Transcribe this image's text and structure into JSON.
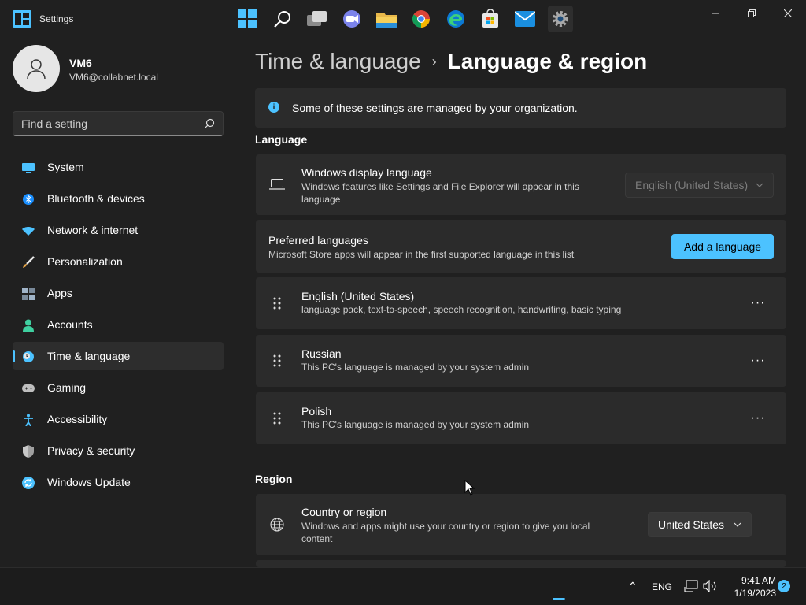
{
  "window": {
    "title": "Settings",
    "controls": {
      "minimize": "–",
      "maximize": "⧉",
      "close": "✕"
    }
  },
  "profile": {
    "name": "VM6",
    "email": "VM6@collabnet.local"
  },
  "search": {
    "placeholder": "Find a setting"
  },
  "sidebar": {
    "items": [
      {
        "label": "System",
        "icon": "system-icon",
        "color": "#4cc2ff"
      },
      {
        "label": "Bluetooth & devices",
        "icon": "bluetooth-icon",
        "color": "#1a8fff"
      },
      {
        "label": "Network & internet",
        "icon": "network-icon",
        "color": "#4cc2ff"
      },
      {
        "label": "Personalization",
        "icon": "brush-icon",
        "color": "#e8a74a"
      },
      {
        "label": "Apps",
        "icon": "apps-icon",
        "color": "#a0b4c8"
      },
      {
        "label": "Accounts",
        "icon": "accounts-icon",
        "color": "#3fd0a0"
      },
      {
        "label": "Time & language",
        "icon": "time-language-icon",
        "color": "#4cc2ff",
        "active": true
      },
      {
        "label": "Gaming",
        "icon": "gaming-icon",
        "color": "#bfbfbf"
      },
      {
        "label": "Accessibility",
        "icon": "accessibility-icon",
        "color": "#4cc2ff"
      },
      {
        "label": "Privacy & security",
        "icon": "shield-icon",
        "color": "#a0a0a0"
      },
      {
        "label": "Windows Update",
        "icon": "update-icon",
        "color": "#4cc2ff"
      }
    ]
  },
  "breadcrumb": {
    "parent": "Time & language",
    "separator": "›",
    "current": "Language & region"
  },
  "info_bar": {
    "icon": "i",
    "text": "Some of these settings are managed by your organization."
  },
  "language_section": {
    "heading": "Language",
    "display_language": {
      "title": "Windows display language",
      "subtitle_line1": "Windows features like Settings and File Explorer will appear in this",
      "subtitle_line2": "language",
      "value": "English (United States)"
    },
    "preferred": {
      "title": "Preferred languages",
      "subtitle": "Microsoft Store apps will appear in the first supported language in this list",
      "button": "Add a language"
    },
    "languages": [
      {
        "name": "English (United States)",
        "detail": "language pack, text-to-speech, speech recognition, handwriting, basic typing",
        "more": "···"
      },
      {
        "name": "Russian",
        "detail": "This PC's language is managed by your system admin",
        "more": "···"
      },
      {
        "name": "Polish",
        "detail": "This PC's language is managed by your system admin",
        "more": "···"
      }
    ]
  },
  "region_section": {
    "heading": "Region",
    "country": {
      "title": "Country or region",
      "subtitle_line1": "Windows and apps might use your country or region to give you local",
      "subtitle_line2": "content",
      "value": "United States"
    }
  },
  "taskbar": {
    "apps": [
      "start-icon",
      "search-icon",
      "task-view-icon",
      "teams-chat-icon",
      "file-explorer-icon",
      "chrome-icon",
      "edge-icon",
      "store-icon",
      "mail-icon",
      "settings-icon"
    ],
    "tray": {
      "chevron": "⌃",
      "language": "ENG",
      "time": "9:41 AM",
      "date": "1/19/2023",
      "notifications": "2"
    }
  },
  "colors": {
    "accent": "#4cc2ff",
    "background": "#202020",
    "card": "#2b2b2b"
  }
}
